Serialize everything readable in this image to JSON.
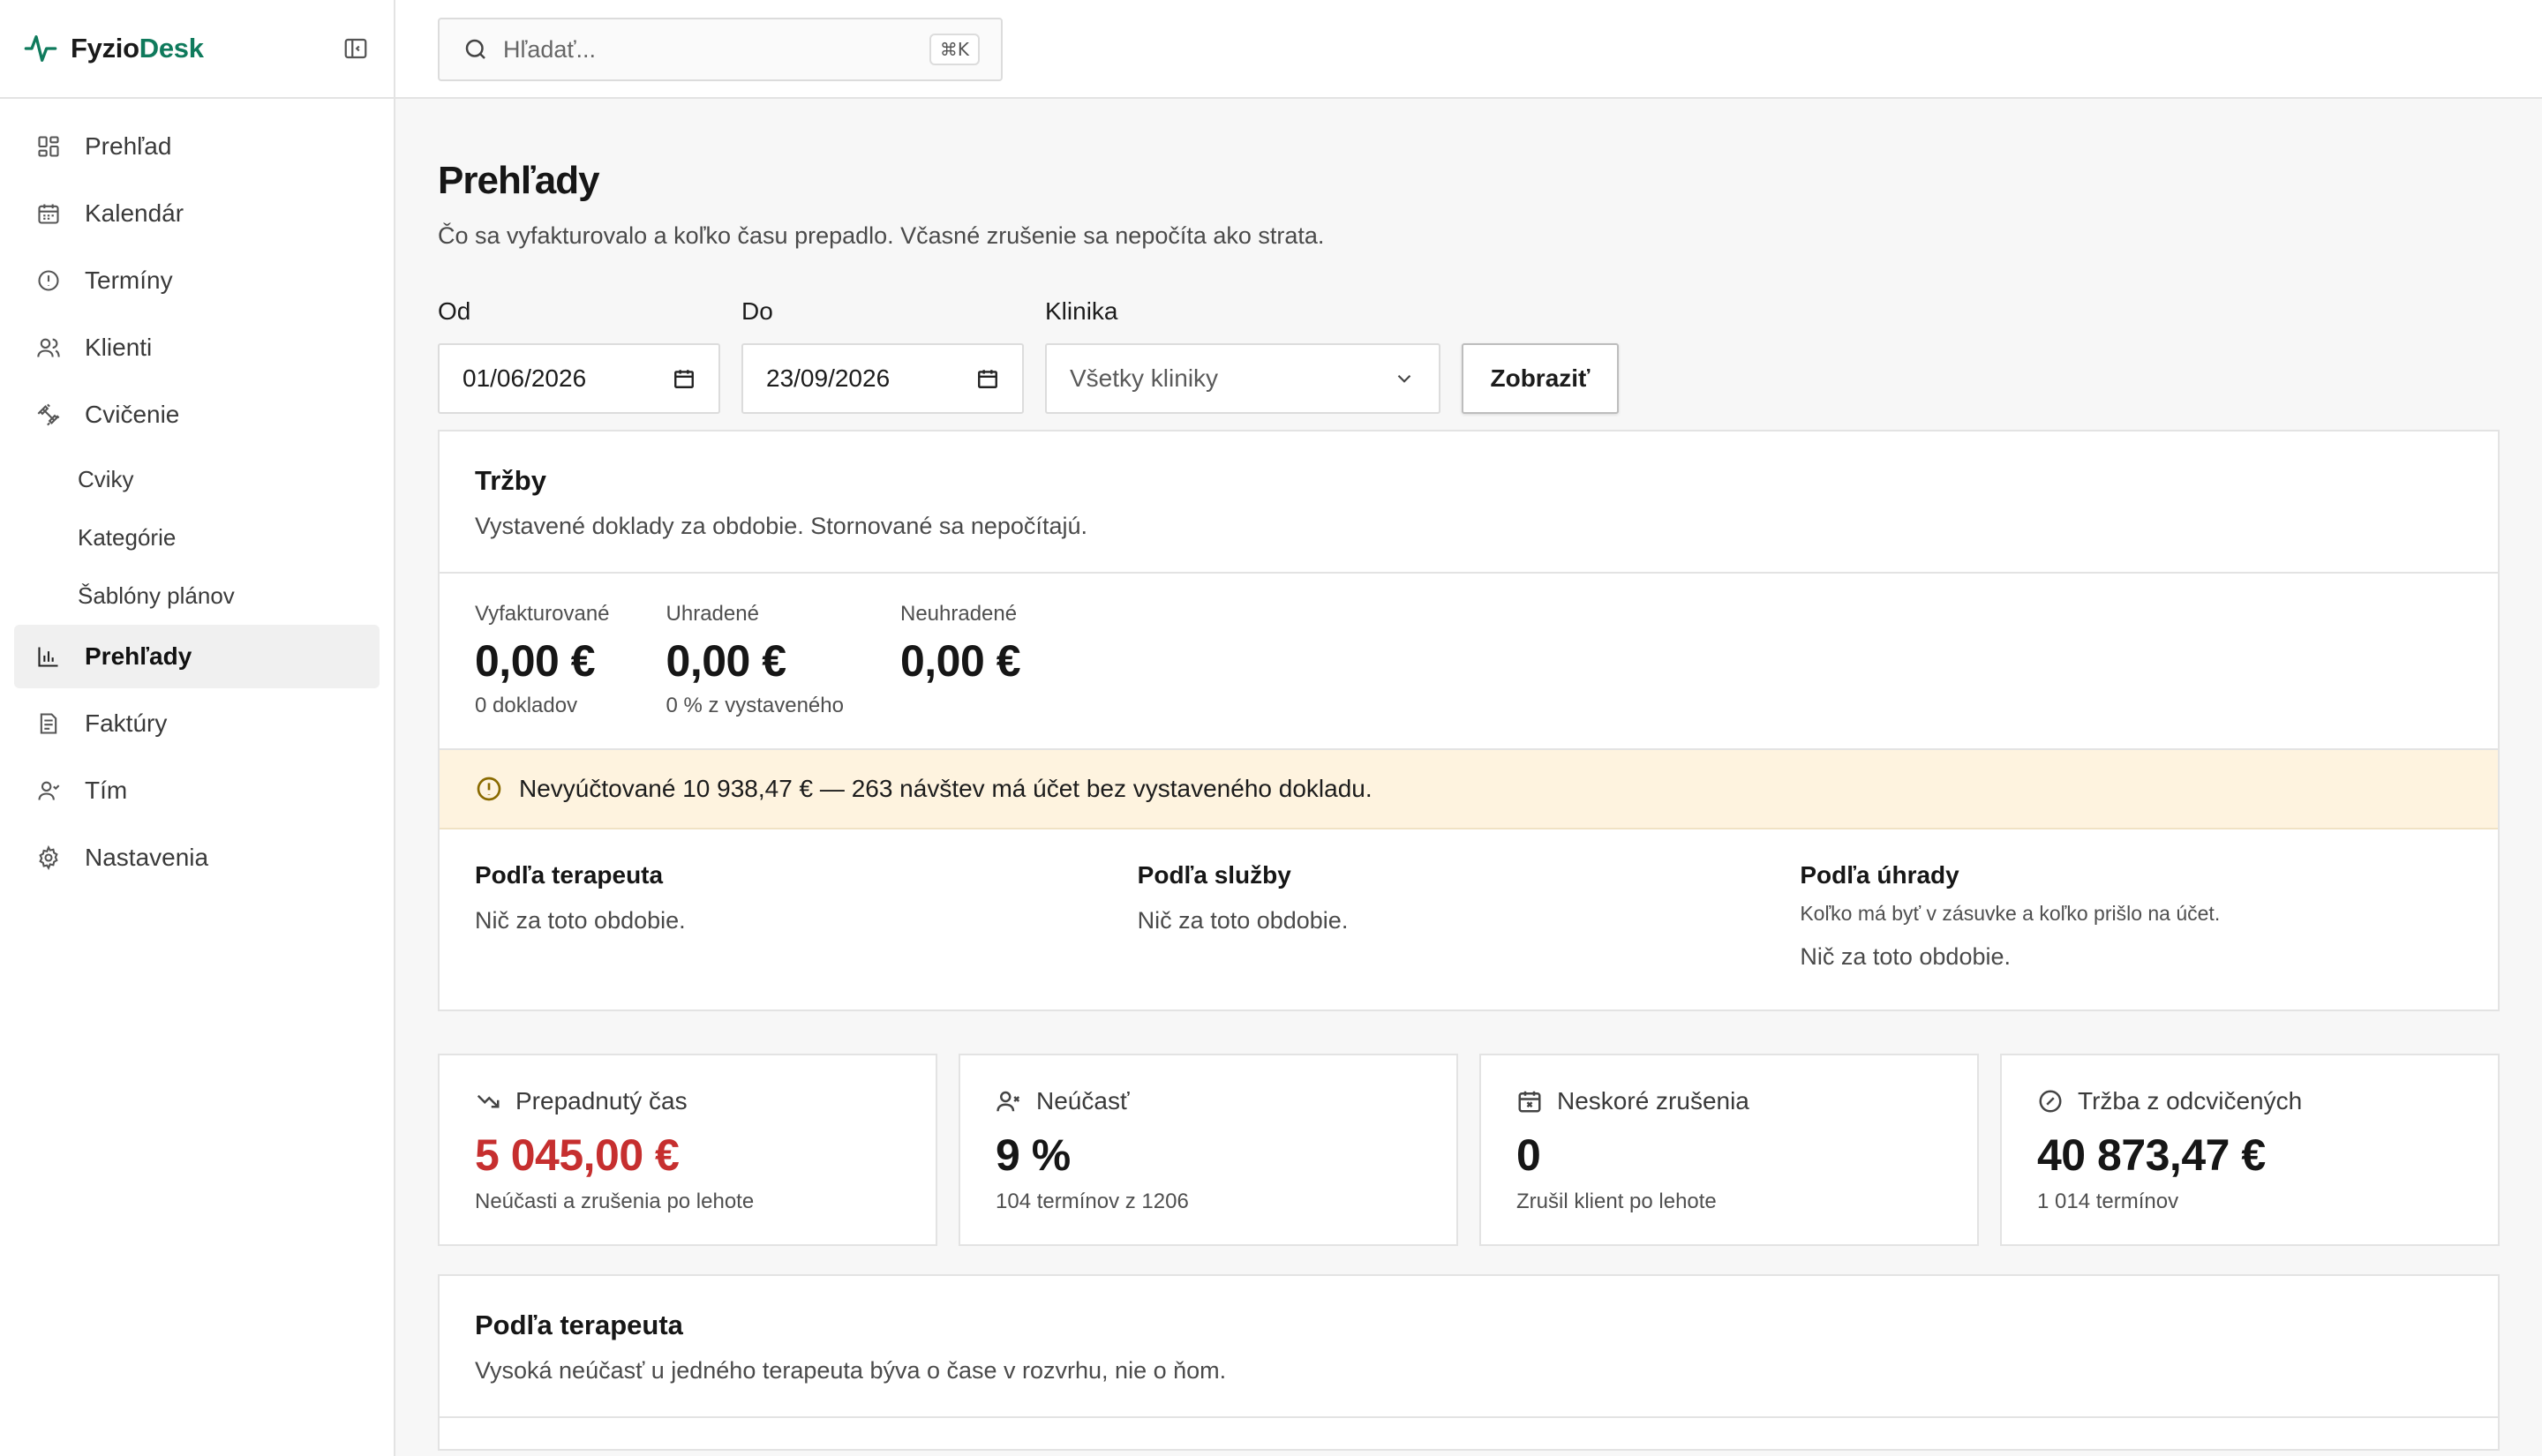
{
  "brand": {
    "name_part1": "Fyzio",
    "name_part2": "Desk",
    "accent_color": "#0f7a5c"
  },
  "sidebar": {
    "items": [
      {
        "label": "Prehľad",
        "icon": "dashboard-icon"
      },
      {
        "label": "Kalendár",
        "icon": "calendar-icon"
      },
      {
        "label": "Termíny",
        "icon": "alert-circle-icon"
      },
      {
        "label": "Klienti",
        "icon": "users-icon"
      },
      {
        "label": "Cvičenie",
        "icon": "dumbbell-icon"
      },
      {
        "label": "Prehľady",
        "icon": "bar-chart-icon",
        "active": true
      },
      {
        "label": "Faktúry",
        "icon": "invoice-icon"
      },
      {
        "label": "Tím",
        "icon": "user-icon"
      },
      {
        "label": "Nastavenia",
        "icon": "gear-icon"
      }
    ],
    "sub_items": [
      "Cviky",
      "Kategórie",
      "Šablóny plánov"
    ]
  },
  "search": {
    "placeholder": "Hľadať...",
    "shortcut": "⌘K"
  },
  "page": {
    "title": "Prehľady",
    "subtitle": "Čo sa vyfakturovalo a koľko času prepadlo. Včasné zrušenie sa nepočíta ako strata."
  },
  "filters": {
    "from_label": "Od",
    "from_value": "01/06/2026",
    "to_label": "Do",
    "to_value": "23/09/2026",
    "clinic_label": "Klinika",
    "clinic_value": "Všetky kliniky",
    "submit_label": "Zobraziť"
  },
  "revenue": {
    "title": "Tržby",
    "subtitle": "Vystavené doklady za obdobie. Stornované sa nepočítajú.",
    "stats": [
      {
        "label": "Vyfakturované",
        "value": "0,00 €",
        "sub": "0 dokladov"
      },
      {
        "label": "Uhradené",
        "value": "0,00 €",
        "sub": "0 % z vystaveného"
      },
      {
        "label": "Neuhradené",
        "value": "0,00 €",
        "sub": ""
      }
    ],
    "warning": "Nevyúčtované 10 938,47 € — 263 návštev má účet bez vystaveného dokladu.",
    "breakdowns": [
      {
        "title": "Podľa terapeuta",
        "note": "",
        "empty": "Nič za toto obdobie."
      },
      {
        "title": "Podľa služby",
        "note": "",
        "empty": "Nič za toto obdobie."
      },
      {
        "title": "Podľa úhrady",
        "note": "Koľko má byť v zásuvke a koľko prišlo na účet.",
        "empty": "Nič za toto obdobie."
      }
    ]
  },
  "kpis": [
    {
      "label": "Prepadnutý čas",
      "value": "5 045,00 €",
      "sub": "Neúčasti a zrušenia po lehote",
      "icon": "trending-down-icon",
      "color": "#c62f2f"
    },
    {
      "label": "Neúčasť",
      "value": "9 %",
      "sub": "104 termínov z 1206",
      "icon": "user-x-icon"
    },
    {
      "label": "Neskoré zrušenia",
      "value": "0",
      "sub": "Zrušil klient po lehote",
      "icon": "calendar-x-icon"
    },
    {
      "label": "Tržba z odcvičených",
      "value": "40 873,47 €",
      "sub": "1 014 termínov",
      "icon": "check-circle-icon"
    }
  ],
  "therapist": {
    "title": "Podľa terapeuta",
    "subtitle": "Vysoká neúčasť u jedného terapeuta býva o čase v rozvrhu, nie o ňom."
  }
}
